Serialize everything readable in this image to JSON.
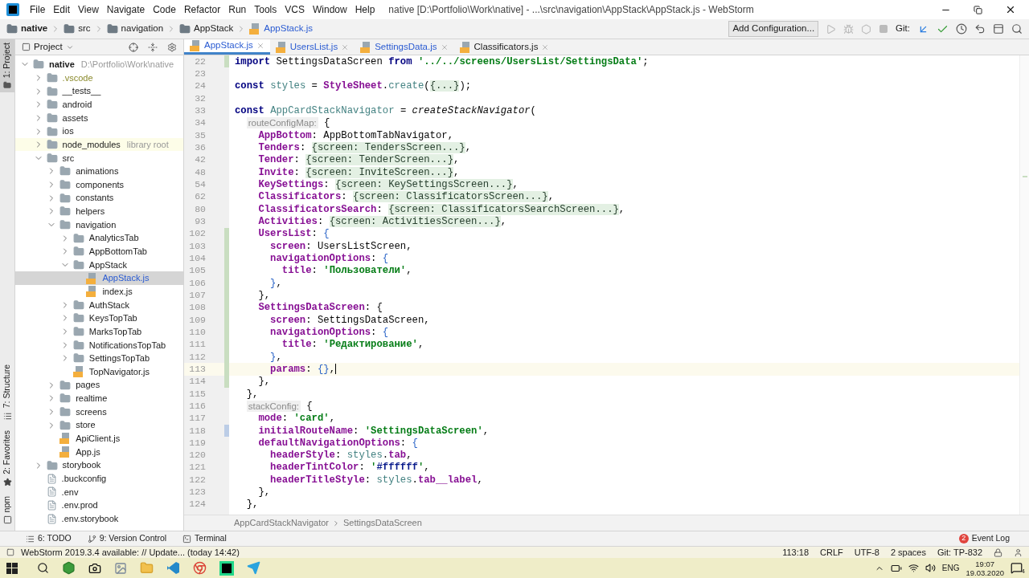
{
  "window": {
    "title": "native [D:\\Portfolio\\Work\\native] - ...\\src\\navigation\\AppStack\\AppStack.js - WebStorm"
  },
  "menu": [
    "File",
    "Edit",
    "View",
    "Navigate",
    "Code",
    "Refactor",
    "Run",
    "Tools",
    "VCS",
    "Window",
    "Help"
  ],
  "nav_path": [
    {
      "text": "native",
      "kind": "folder"
    },
    {
      "text": "src",
      "kind": "folder"
    },
    {
      "text": "navigation",
      "kind": "folder"
    },
    {
      "text": "AppStack",
      "kind": "folder"
    },
    {
      "text": "AppStack.js",
      "kind": "js"
    }
  ],
  "toolbar": {
    "config_button": "Add Configuration...",
    "git_label": "Git:"
  },
  "left_strip": {
    "top": [
      {
        "text": "1: Project",
        "selected": true
      }
    ],
    "bottom": [
      {
        "text": "7: Structure",
        "kind": "structure",
        "selected": false
      },
      {
        "text": "2: Favorites",
        "kind": "star",
        "selected": false
      },
      {
        "text": "npm",
        "kind": "npm",
        "selected": false
      }
    ]
  },
  "project": {
    "title": "Project",
    "tree": [
      {
        "name": "native",
        "note": "D:\\Portfolio\\Work\\native",
        "kind": "folder",
        "expanded": true,
        "selected": false,
        "modified": false,
        "children": [
          {
            "name": ".vscode",
            "kind": "ignored-folder",
            "expanded": false,
            "selected": false,
            "modified": false
          },
          {
            "name": "__tests__",
            "kind": "folder",
            "expanded": false,
            "selected": false,
            "modified": false
          },
          {
            "name": "android",
            "kind": "folder",
            "expanded": false,
            "selected": false,
            "modified": false
          },
          {
            "name": "assets",
            "kind": "folder",
            "expanded": false,
            "selected": false,
            "modified": false
          },
          {
            "name": "ios",
            "kind": "folder",
            "expanded": false,
            "selected": false,
            "modified": false
          },
          {
            "name": "node_modules",
            "note": "library root",
            "kind": "library-folder",
            "expanded": false,
            "selected": false,
            "modified": false
          },
          {
            "name": "src",
            "kind": "folder",
            "expanded": true,
            "selected": false,
            "modified": false,
            "children": [
              {
                "name": "animations",
                "kind": "folder",
                "expanded": false,
                "selected": false,
                "modified": false
              },
              {
                "name": "components",
                "kind": "folder",
                "expanded": false,
                "selected": false,
                "modified": false
              },
              {
                "name": "constants",
                "kind": "folder",
                "expanded": false,
                "selected": false,
                "modified": false
              },
              {
                "name": "helpers",
                "kind": "folder",
                "expanded": false,
                "selected": false,
                "modified": false
              },
              {
                "name": "navigation",
                "kind": "folder",
                "expanded": true,
                "selected": false,
                "modified": false,
                "children": [
                  {
                    "name": "AnalyticsTab",
                    "kind": "folder",
                    "expanded": false,
                    "selected": false,
                    "modified": false
                  },
                  {
                    "name": "AppBottomTab",
                    "kind": "folder",
                    "expanded": false,
                    "selected": false,
                    "modified": false
                  },
                  {
                    "name": "AppStack",
                    "kind": "folder",
                    "expanded": true,
                    "selected": false,
                    "modified": false,
                    "children": [
                      {
                        "name": "AppStack.js",
                        "kind": "js",
                        "selected": true,
                        "modified": true
                      },
                      {
                        "name": "index.js",
                        "kind": "js",
                        "selected": false,
                        "modified": false
                      }
                    ]
                  },
                  {
                    "name": "AuthStack",
                    "kind": "folder",
                    "expanded": false,
                    "selected": false,
                    "modified": false
                  },
                  {
                    "name": "KeysTopTab",
                    "kind": "folder",
                    "expanded": false,
                    "selected": false,
                    "modified": false
                  },
                  {
                    "name": "MarksTopTab",
                    "kind": "folder",
                    "expanded": false,
                    "selected": false,
                    "modified": false
                  },
                  {
                    "name": "NotificationsTopTab",
                    "kind": "folder",
                    "expanded": false,
                    "selected": false,
                    "modified": false
                  },
                  {
                    "name": "SettingsTopTab",
                    "kind": "folder",
                    "expanded": false,
                    "selected": false,
                    "modified": false
                  },
                  {
                    "name": "TopNavigator.js",
                    "kind": "js",
                    "selected": false,
                    "modified": false
                  }
                ]
              },
              {
                "name": "pages",
                "kind": "folder",
                "expanded": false,
                "selected": false,
                "modified": false
              },
              {
                "name": "realtime",
                "kind": "folder",
                "expanded": false,
                "selected": false,
                "modified": false
              },
              {
                "name": "screens",
                "kind": "folder",
                "expanded": false,
                "selected": false,
                "modified": false
              },
              {
                "name": "store",
                "kind": "folder",
                "expanded": false,
                "selected": false,
                "modified": false
              },
              {
                "name": "ApiClient.js",
                "kind": "js",
                "selected": false,
                "modified": false
              },
              {
                "name": "App.js",
                "kind": "js",
                "selected": false,
                "modified": false
              }
            ]
          },
          {
            "name": "storybook",
            "kind": "folder",
            "expanded": false,
            "selected": false,
            "modified": false
          },
          {
            "name": ".buckconfig",
            "kind": "file",
            "selected": false,
            "modified": false
          },
          {
            "name": ".env",
            "kind": "file",
            "selected": false,
            "modified": false
          },
          {
            "name": ".env.prod",
            "kind": "file",
            "selected": false,
            "modified": false
          },
          {
            "name": ".env.storybook",
            "kind": "file",
            "selected": false,
            "modified": false
          }
        ]
      }
    ]
  },
  "editor_tabs": [
    {
      "label": "AppStack.js",
      "selected": true,
      "modified": true
    },
    {
      "label": "UsersList.js",
      "selected": false,
      "modified": true
    },
    {
      "label": "SettingsData.js",
      "selected": false,
      "modified": true
    },
    {
      "label": "Classificators.js",
      "selected": false,
      "modified": false
    }
  ],
  "code": [
    {
      "number": "22",
      "current": false,
      "added": true,
      "modified": false,
      "tokens": [
        {
          "kind": "kw",
          "text": "import"
        },
        {
          "kind": "id",
          "text": " SettingsDataScreen "
        },
        {
          "kind": "kw",
          "text": "from"
        },
        {
          "kind": "str",
          "text": " '../../screens/UsersList/SettingsData'"
        },
        {
          "kind": "id",
          "text": ";"
        }
      ]
    },
    {
      "number": "23",
      "current": false,
      "added": false,
      "modified": false
    },
    {
      "number": "24",
      "current": false,
      "added": false,
      "modified": false,
      "tokens": [
        {
          "kind": "kw",
          "text": "const"
        },
        {
          "kind": "var",
          "text": " styles"
        },
        {
          "kind": "id",
          "text": " = "
        },
        {
          "kind": "prop",
          "text": "StyleSheet"
        },
        {
          "kind": "id",
          "text": "."
        },
        {
          "kind": "var",
          "text": "create"
        },
        {
          "kind": "id",
          "text": "("
        },
        {
          "kind": "fold",
          "text": "{...}"
        },
        {
          "kind": "id",
          "text": ");"
        }
      ]
    },
    {
      "number": "32",
      "current": false,
      "added": false,
      "modified": false
    },
    {
      "number": "33",
      "current": false,
      "added": false,
      "modified": false,
      "tokens": [
        {
          "kind": "kw",
          "text": "const"
        },
        {
          "kind": "var",
          "text": " AppCardStackNavigator"
        },
        {
          "kind": "id",
          "text": " = "
        },
        {
          "kind": "fn",
          "text": "createStackNavigator"
        },
        {
          "kind": "id",
          "text": "("
        }
      ]
    },
    {
      "number": "34",
      "current": false,
      "added": false,
      "modified": false,
      "tokens": [
        {
          "kind": "hint",
          "text": "  routeConfigMap:"
        },
        {
          "kind": "id",
          "text": " {"
        }
      ]
    },
    {
      "number": "35",
      "current": false,
      "added": false,
      "modified": false,
      "tokens": [
        {
          "kind": "prop",
          "text": "    AppBottom"
        },
        {
          "kind": "id",
          "text": ": AppBottomTabNavigator,"
        }
      ]
    },
    {
      "number": "36",
      "current": false,
      "added": false,
      "modified": false,
      "tokens": [
        {
          "kind": "prop",
          "text": "    Tenders"
        },
        {
          "kind": "id",
          "text": ": "
        },
        {
          "kind": "fold",
          "text": "{screen: TendersScreen...}"
        },
        {
          "kind": "id",
          "text": ","
        }
      ]
    },
    {
      "number": "42",
      "current": false,
      "added": false,
      "modified": false,
      "tokens": [
        {
          "kind": "prop",
          "text": "    Tender"
        },
        {
          "kind": "id",
          "text": ": "
        },
        {
          "kind": "fold",
          "text": "{screen: TenderScreen...}"
        },
        {
          "kind": "id",
          "text": ","
        }
      ]
    },
    {
      "number": "48",
      "current": false,
      "added": false,
      "modified": false,
      "tokens": [
        {
          "kind": "prop",
          "text": "    Invite"
        },
        {
          "kind": "id",
          "text": ": "
        },
        {
          "kind": "fold",
          "text": "{screen: InviteScreen...}"
        },
        {
          "kind": "id",
          "text": ","
        }
      ]
    },
    {
      "number": "54",
      "current": false,
      "added": false,
      "modified": false,
      "tokens": [
        {
          "kind": "prop",
          "text": "    KeySettings"
        },
        {
          "kind": "id",
          "text": ": "
        },
        {
          "kind": "fold",
          "text": "{screen: KeySettingsScreen...}"
        },
        {
          "kind": "id",
          "text": ","
        }
      ]
    },
    {
      "number": "62",
      "current": false,
      "added": false,
      "modified": false,
      "tokens": [
        {
          "kind": "prop",
          "text": "    Classificators"
        },
        {
          "kind": "id",
          "text": ": "
        },
        {
          "kind": "fold",
          "text": "{screen: ClassificatorsScreen...}"
        },
        {
          "kind": "id",
          "text": ","
        }
      ]
    },
    {
      "number": "80",
      "current": false,
      "added": false,
      "modified": false,
      "tokens": [
        {
          "kind": "prop",
          "text": "    ClassificatorsSearch"
        },
        {
          "kind": "id",
          "text": ": "
        },
        {
          "kind": "fold",
          "text": "{screen: ClassificatorsSearchScreen...}"
        },
        {
          "kind": "id",
          "text": ","
        }
      ]
    },
    {
      "number": "93",
      "current": false,
      "added": false,
      "modified": false,
      "tokens": [
        {
          "kind": "prop",
          "text": "    Activities"
        },
        {
          "kind": "id",
          "text": ": "
        },
        {
          "kind": "fold",
          "text": "{screen: ActivitiesScreen...}"
        },
        {
          "kind": "id",
          "text": ","
        }
      ]
    },
    {
      "number": "102",
      "current": false,
      "added": true,
      "modified": false,
      "tokens": [
        {
          "kind": "prop",
          "text": "    UsersList"
        },
        {
          "kind": "id",
          "text": ": "
        },
        {
          "kind": "brace",
          "text": "{"
        }
      ]
    },
    {
      "number": "103",
      "current": false,
      "added": true,
      "modified": false,
      "tokens": [
        {
          "kind": "prop",
          "text": "      screen"
        },
        {
          "kind": "id",
          "text": ": UsersListScreen,"
        }
      ]
    },
    {
      "number": "104",
      "current": false,
      "added": true,
      "modified": false,
      "tokens": [
        {
          "kind": "prop",
          "text": "      navigationOptions"
        },
        {
          "kind": "id",
          "text": ": "
        },
        {
          "kind": "brace",
          "text": "{"
        }
      ]
    },
    {
      "number": "105",
      "current": false,
      "added": true,
      "modified": false,
      "tokens": [
        {
          "kind": "prop",
          "text": "        title"
        },
        {
          "kind": "id",
          "text": ": "
        },
        {
          "kind": "str",
          "text": "'Пользователи'"
        },
        {
          "kind": "id",
          "text": ","
        }
      ]
    },
    {
      "number": "106",
      "current": false,
      "added": true,
      "modified": false,
      "tokens": [
        {
          "kind": "brace",
          "text": "      }"
        },
        {
          "kind": "id",
          "text": ","
        }
      ]
    },
    {
      "number": "107",
      "current": false,
      "added": true,
      "modified": false,
      "tokens": [
        {
          "kind": "id",
          "text": "    },"
        }
      ]
    },
    {
      "number": "108",
      "current": false,
      "added": true,
      "modified": false,
      "tokens": [
        {
          "kind": "prop",
          "text": "    SettingsDataScreen"
        },
        {
          "kind": "id",
          "text": ": {"
        }
      ]
    },
    {
      "number": "109",
      "current": false,
      "added": true,
      "modified": false,
      "tokens": [
        {
          "kind": "prop",
          "text": "      screen"
        },
        {
          "kind": "id",
          "text": ": SettingsDataScreen,"
        }
      ]
    },
    {
      "number": "110",
      "current": false,
      "added": true,
      "modified": false,
      "tokens": [
        {
          "kind": "prop",
          "text": "      navigationOptions"
        },
        {
          "kind": "id",
          "text": ": "
        },
        {
          "kind": "brace",
          "text": "{"
        }
      ]
    },
    {
      "number": "111",
      "current": false,
      "added": true,
      "modified": false,
      "tokens": [
        {
          "kind": "prop",
          "text": "        title"
        },
        {
          "kind": "id",
          "text": ": "
        },
        {
          "kind": "str",
          "text": "'Редактирование'"
        },
        {
          "kind": "id",
          "text": ","
        }
      ]
    },
    {
      "number": "112",
      "current": false,
      "added": true,
      "modified": false,
      "tokens": [
        {
          "kind": "brace",
          "text": "      }"
        },
        {
          "kind": "id",
          "text": ","
        }
      ]
    },
    {
      "number": "113",
      "current": true,
      "added": true,
      "modified": false,
      "tokens": [
        {
          "kind": "prop",
          "text": "      params"
        },
        {
          "kind": "id",
          "text": ": "
        },
        {
          "kind": "brace",
          "text": "{}"
        },
        {
          "kind": "id",
          "text": ","
        }
      ]
    },
    {
      "number": "114",
      "current": false,
      "added": true,
      "modified": false,
      "tokens": [
        {
          "kind": "id",
          "text": "    },"
        }
      ]
    },
    {
      "number": "115",
      "current": false,
      "added": false,
      "modified": false,
      "tokens": [
        {
          "kind": "id",
          "text": "  },"
        }
      ]
    },
    {
      "number": "116",
      "current": false,
      "added": false,
      "modified": false,
      "tokens": [
        {
          "kind": "hint",
          "text": "  stackConfig:"
        },
        {
          "kind": "id",
          "text": " {"
        }
      ]
    },
    {
      "number": "117",
      "current": false,
      "added": false,
      "modified": false,
      "tokens": [
        {
          "kind": "prop",
          "text": "    mode"
        },
        {
          "kind": "id",
          "text": ": "
        },
        {
          "kind": "str",
          "text": "'card'"
        },
        {
          "kind": "id",
          "text": ","
        }
      ]
    },
    {
      "number": "118",
      "current": false,
      "added": false,
      "modified": true,
      "tokens": [
        {
          "kind": "prop",
          "text": "    initialRouteName"
        },
        {
          "kind": "id",
          "text": ": "
        },
        {
          "kind": "str",
          "text": "'SettingsDataScreen'"
        },
        {
          "kind": "id",
          "text": ","
        }
      ]
    },
    {
      "number": "119",
      "current": false,
      "added": false,
      "modified": false,
      "tokens": [
        {
          "kind": "prop",
          "text": "    defaultNavigationOptions"
        },
        {
          "kind": "id",
          "text": ": "
        },
        {
          "kind": "brace",
          "text": "{"
        }
      ]
    },
    {
      "number": "120",
      "current": false,
      "added": false,
      "modified": false,
      "tokens": [
        {
          "kind": "prop",
          "text": "      headerStyle"
        },
        {
          "kind": "id",
          "text": ": "
        },
        {
          "kind": "var",
          "text": "styles"
        },
        {
          "kind": "id",
          "text": "."
        },
        {
          "kind": "prop",
          "text": "tab"
        },
        {
          "kind": "id",
          "text": ","
        }
      ]
    },
    {
      "number": "121",
      "current": false,
      "added": false,
      "modified": false,
      "tokens": [
        {
          "kind": "prop",
          "text": "      headerTintColor"
        },
        {
          "kind": "id",
          "text": ": "
        },
        {
          "kind": "str",
          "text": "'"
        },
        {
          "kind": "hex",
          "text": "#ffffff"
        },
        {
          "kind": "str",
          "text": "'"
        },
        {
          "kind": "id",
          "text": ","
        }
      ]
    },
    {
      "number": "122",
      "current": false,
      "added": false,
      "modified": false,
      "tokens": [
        {
          "kind": "prop",
          "text": "      headerTitleStyle"
        },
        {
          "kind": "id",
          "text": ": "
        },
        {
          "kind": "var",
          "text": "styles"
        },
        {
          "kind": "id",
          "text": "."
        },
        {
          "kind": "prop",
          "text": "tab__label"
        },
        {
          "kind": "id",
          "text": ","
        }
      ]
    },
    {
      "number": "123",
      "current": false,
      "added": false,
      "modified": false,
      "tokens": [
        {
          "kind": "id",
          "text": "    },"
        }
      ]
    },
    {
      "number": "124",
      "current": false,
      "added": false,
      "modified": false,
      "tokens": [
        {
          "kind": "id",
          "text": "  },"
        }
      ]
    }
  ],
  "breadcrumbs": [
    "AppCardStackNavigator",
    "SettingsDataScreen"
  ],
  "tool_windows": [
    {
      "text": "6: TODO",
      "kind": "list"
    },
    {
      "text": "9: Version Control",
      "kind": "vcs"
    },
    {
      "text": "Terminal",
      "kind": "terminal"
    }
  ],
  "event_log": {
    "label": "Event Log",
    "count": "2"
  },
  "status_bar": {
    "message": "WebStorm 2019.3.4 available: // Update... (today 14:42)",
    "items": [
      "113:18",
      "CRLF",
      "UTF-8",
      "2 spaces",
      "Git: TP-832"
    ]
  },
  "taskbar": {
    "language": "ENG",
    "time": "19:07",
    "date": "19.03.2020",
    "notifications": "4"
  }
}
